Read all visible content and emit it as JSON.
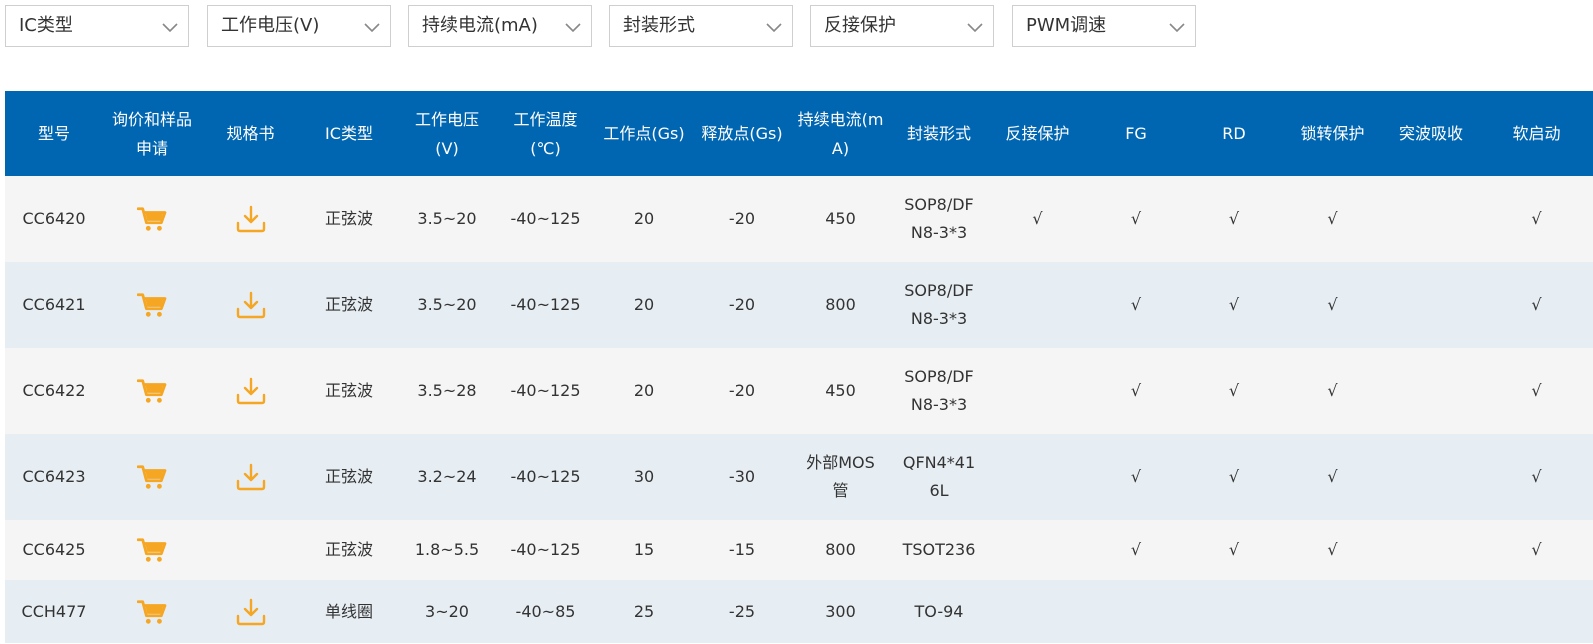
{
  "filters": [
    {
      "label": "IC类型"
    },
    {
      "label": "工作电压(V)"
    },
    {
      "label": "持续电流(mA)"
    },
    {
      "label": "封装形式"
    },
    {
      "label": "反接保护"
    },
    {
      "label": "PWM调速"
    }
  ],
  "colors": {
    "header_bg": "#0066b1",
    "icon_accent": "#f5a623",
    "row_alt": "#e6edf3"
  },
  "table": {
    "headers": [
      "型号",
      "询价和样品申请",
      "规格书",
      "IC类型",
      "工作电压(V)",
      "工作温度(℃)",
      "工作点(Gs)",
      "释放点(Gs)",
      "持续电流(mA)",
      "封装形式",
      "反接保护",
      "FG",
      "RD",
      "锁转保护",
      "突波吸收",
      "软启动"
    ],
    "rows": [
      {
        "model": "CC6420",
        "cart": "cart-icon",
        "datasheet": "download-icon",
        "ic_type": "正弦波",
        "voltage": "3.5~20",
        "temp": "-40~125",
        "op": "20",
        "rel": "-20",
        "current": "450",
        "package": "SOP8/DFN8-3*3",
        "reverse": "√",
        "fg": "√",
        "rd": "√",
        "lock": "√",
        "surge": "",
        "soft": "√"
      },
      {
        "model": "CC6421",
        "cart": "cart-icon",
        "datasheet": "download-icon",
        "ic_type": "正弦波",
        "voltage": "3.5~20",
        "temp": "-40~125",
        "op": "20",
        "rel": "-20",
        "current": "800",
        "package": "SOP8/DFN8-3*3",
        "reverse": "",
        "fg": "√",
        "rd": "√",
        "lock": "√",
        "surge": "",
        "soft": "√"
      },
      {
        "model": "CC6422",
        "cart": "cart-icon",
        "datasheet": "download-icon",
        "ic_type": "正弦波",
        "voltage": "3.5~28",
        "temp": "-40~125",
        "op": "20",
        "rel": "-20",
        "current": "450",
        "package": "SOP8/DFN8-3*3",
        "reverse": "",
        "fg": "√",
        "rd": "√",
        "lock": "√",
        "surge": "",
        "soft": "√"
      },
      {
        "model": "CC6423",
        "cart": "cart-icon",
        "datasheet": "download-icon",
        "ic_type": "正弦波",
        "voltage": "3.2~24",
        "temp": "-40~125",
        "op": "30",
        "rel": "-30",
        "current": "外部MOS管",
        "package": "QFN4*416L",
        "reverse": "",
        "fg": "√",
        "rd": "√",
        "lock": "√",
        "surge": "",
        "soft": "√"
      },
      {
        "model": "CC6425",
        "cart": "cart-icon",
        "datasheet": "",
        "ic_type": "正弦波",
        "voltage": "1.8~5.5",
        "temp": "-40~125",
        "op": "15",
        "rel": "-15",
        "current": "800",
        "package": "TSOT236",
        "reverse": "",
        "fg": "√",
        "rd": "√",
        "lock": "√",
        "surge": "",
        "soft": "√"
      },
      {
        "model": "CCH477",
        "cart": "cart-icon",
        "datasheet": "download-icon",
        "ic_type": "单线圈",
        "voltage": "3~20",
        "temp": "-40~85",
        "op": "25",
        "rel": "-25",
        "current": "300",
        "package": "TO-94",
        "reverse": "",
        "fg": "",
        "rd": "",
        "lock": "",
        "surge": "",
        "soft": ""
      }
    ]
  }
}
